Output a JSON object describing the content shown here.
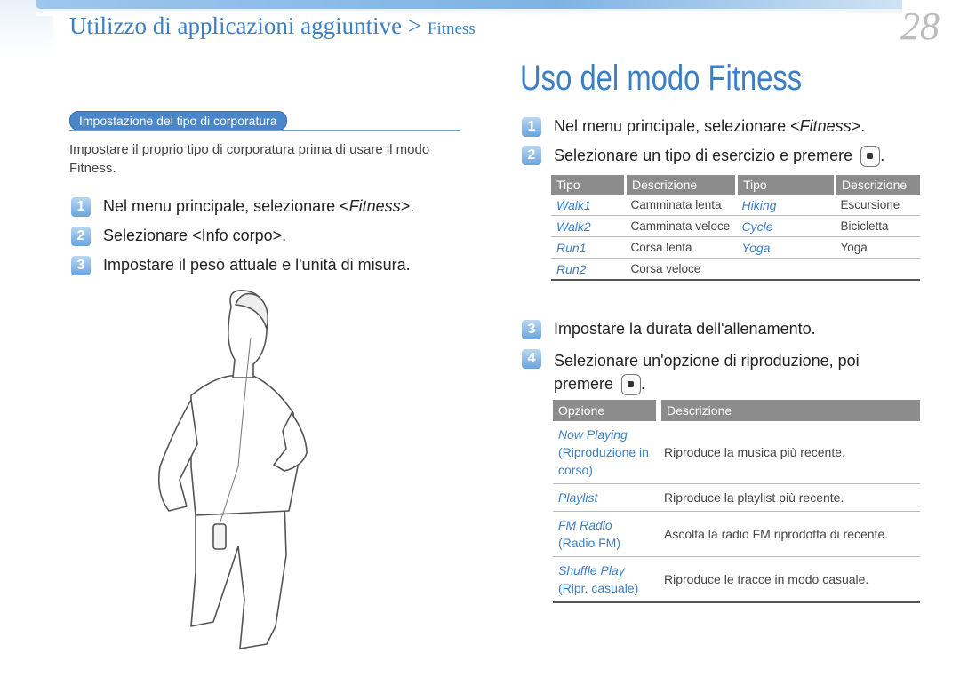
{
  "header": {
    "section": "Utilizzo di applicazioni aggiuntive",
    "separator": ">",
    "subsection": "Fitness",
    "page_number": "28"
  },
  "main_title": "Uso del modo Fitness",
  "left": {
    "pill_label": "Impostazione del tipo di corporatura",
    "intro": "Impostare il proprio tipo di corporatura prima di usare il modo Fitness.",
    "steps": [
      {
        "num": "1",
        "pre": "Nel menu principale, selezionare <",
        "em": "Fitness",
        "post": ">."
      },
      {
        "num": "2",
        "text": "Selezionare <Info corpo>."
      },
      {
        "num": "3",
        "text": "Impostare il peso attuale e l'unità di misura."
      }
    ],
    "figure_alt": "runner-illustration"
  },
  "right": {
    "steps": [
      {
        "num": "1",
        "pre": "Nel menu principale, selezionare <",
        "em": "Fitness",
        "post": ">."
      },
      {
        "num": "2",
        "text": "Selezionare un tipo di esercizio e premere",
        "post": "."
      },
      {
        "num": "3",
        "text": "Impostare la durata dell'allenamento."
      },
      {
        "num": "4",
        "text": "Selezionare un'opzione di riproduzione, poi",
        "text2": "premere",
        "post": "."
      }
    ],
    "exercise_table": {
      "headers": [
        "Tipo",
        "Descrizione",
        "Tipo",
        "Descrizione"
      ],
      "rows": [
        [
          "Walk1",
          "Camminata lenta",
          "Hiking",
          "Escursione"
        ],
        [
          "Walk2",
          "Camminata veloce",
          "Cycle",
          "Bicicletta"
        ],
        [
          "Run1",
          "Corsa lenta",
          "Yoga",
          "Yoga"
        ],
        [
          "Run2",
          "Corsa veloce",
          "",
          ""
        ]
      ]
    },
    "option_table": {
      "headers": [
        "Opzione",
        "Descrizione"
      ],
      "rows": [
        {
          "name": "Now Playing",
          "alt": "(Riproduzione in corso)",
          "desc": "Riproduce la musica più recente."
        },
        {
          "name": "Playlist",
          "alt": "",
          "desc": "Riproduce la playlist più recente."
        },
        {
          "name": "FM Radio",
          "alt": "(Radio FM)",
          "desc": "Ascolta la radio FM riprodotta di recente."
        },
        {
          "name": "Shuffle Play",
          "alt": "(Ripr. casuale)",
          "desc": "Riproduce le tracce in modo casuale."
        }
      ]
    }
  }
}
